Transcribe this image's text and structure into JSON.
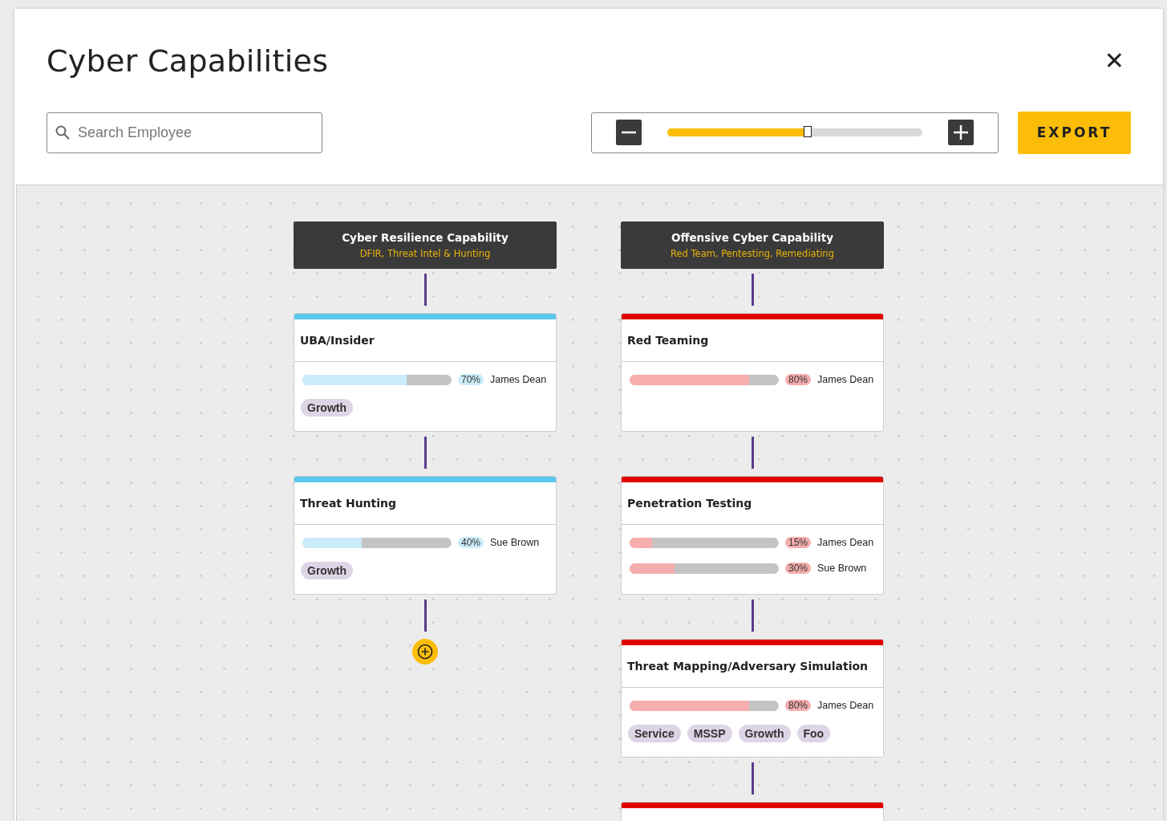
{
  "dialog": {
    "title": "Cyber Capabilities",
    "close_label": "✕"
  },
  "search": {
    "placeholder": "Search Employee"
  },
  "zoom": {
    "level": 0.55
  },
  "export_button": "EXPORT",
  "columns": [
    {
      "title": "Cyber Resilience Capability",
      "subtitle": "DFIR, Threat Intel & Hunting",
      "color": "#5bc8ee",
      "nodes": [
        {
          "kind": "card",
          "title": "UBA/Insider",
          "skills": [
            {
              "level": 0.7,
              "percent": "70%",
              "employee": "James Dean"
            }
          ],
          "tags": [
            "Growth"
          ]
        },
        {
          "kind": "card",
          "title": "Threat Hunting",
          "skills": [
            {
              "level": 0.4,
              "percent": "40%",
              "employee": "Sue Brown"
            }
          ],
          "tags": [
            "Growth"
          ]
        },
        {
          "kind": "add"
        }
      ]
    },
    {
      "title": "Offensive Cyber Capability",
      "subtitle": "Red Team, Pentesting, Remediating",
      "color": "#e00000",
      "nodes": [
        {
          "kind": "card",
          "title": "Red Teaming",
          "skills": [
            {
              "level": 0.8,
              "percent": "80%",
              "employee": "James Dean"
            }
          ]
        },
        {
          "kind": "card",
          "title": "Penetration Testing",
          "skills": [
            {
              "level": 0.15,
              "percent": "15%",
              "employee": "James Dean"
            },
            {
              "level": 0.3,
              "percent": "30%",
              "employee": "Sue Brown"
            }
          ]
        },
        {
          "kind": "card",
          "title": "Threat Mapping/Adversary Simulation",
          "skills": [
            {
              "level": 0.8,
              "percent": "80%",
              "employee": "James Dean"
            }
          ],
          "tags": [
            "Service",
            "MSSP",
            "Growth",
            "Foo"
          ]
        },
        {
          "kind": "partial"
        }
      ]
    }
  ]
}
